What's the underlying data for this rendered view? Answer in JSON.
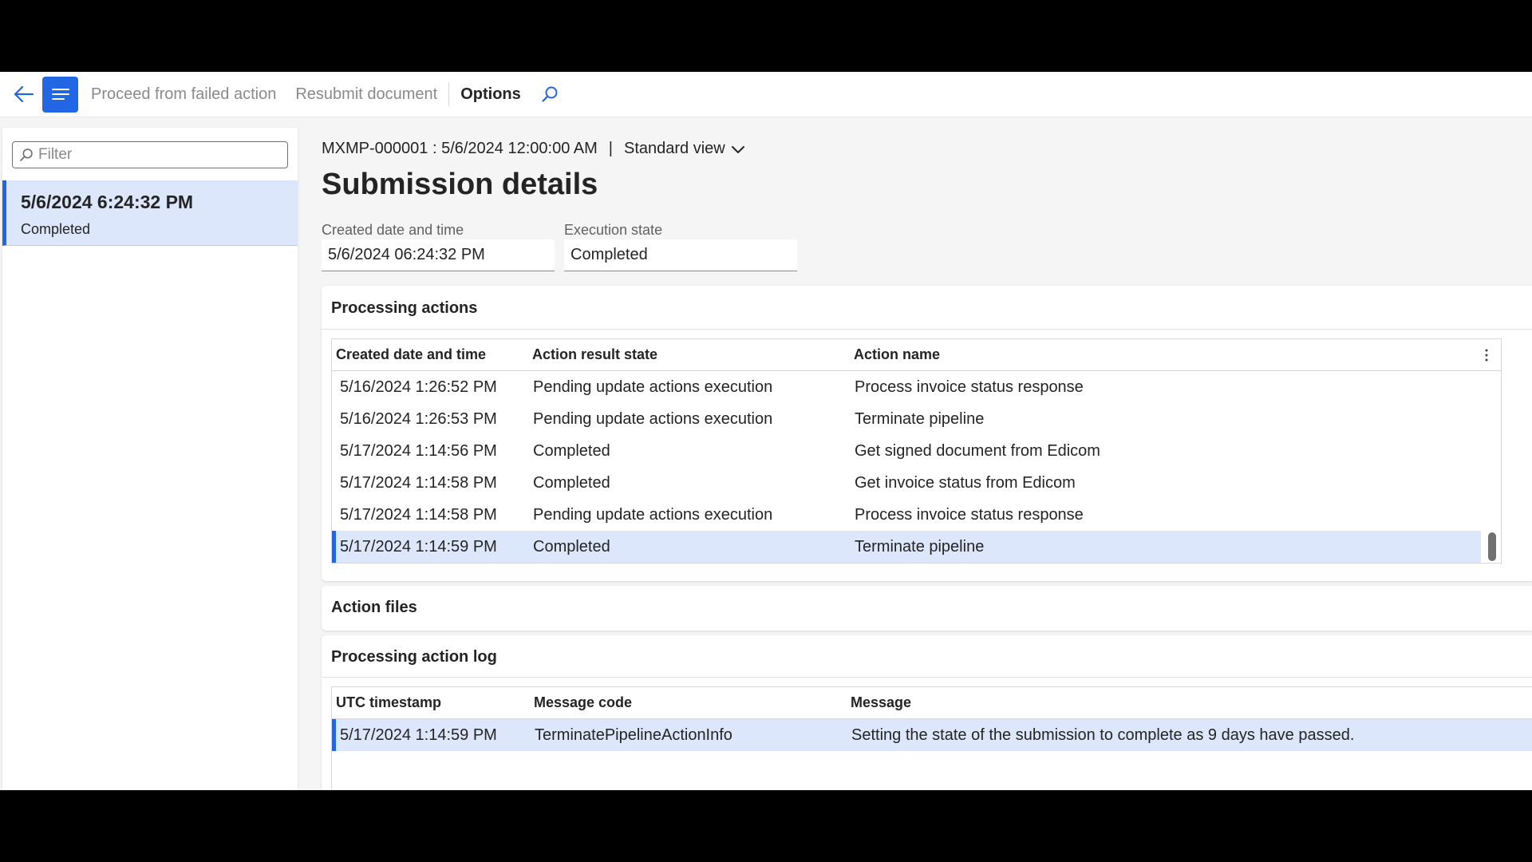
{
  "toolbar": {
    "back_icon": "back-arrow-icon",
    "menu_icon": "menu-lines-icon",
    "proceed_label": "Proceed from failed action",
    "resubmit_label": "Resubmit document",
    "options_label": "Options",
    "search_icon": "search-icon"
  },
  "left_pane": {
    "filter_placeholder": "Filter",
    "items": [
      {
        "title": "5/6/2024 6:24:32 PM",
        "status": "Completed"
      }
    ]
  },
  "header": {
    "record": "MXMP-000001 : 5/6/2024 12:00:00 AM",
    "separator": "|",
    "view_label": "Standard view",
    "title": "Submission details"
  },
  "fields": {
    "created_label": "Created date and time",
    "created_value": "5/6/2024 06:24:32 PM",
    "execution_label": "Execution state",
    "execution_value": "Completed"
  },
  "processing_actions": {
    "title": "Processing actions",
    "columns": [
      "Created date and time",
      "Action result state",
      "Action name"
    ],
    "rows": [
      [
        "5/16/2024 1:26:52 PM",
        "Pending update actions execution",
        "Process invoice status response"
      ],
      [
        "5/16/2024 1:26:53 PM",
        "Pending update actions execution",
        "Terminate pipeline"
      ],
      [
        "5/17/2024 1:14:56 PM",
        "Completed",
        "Get signed document from Edicom"
      ],
      [
        "5/17/2024 1:14:58 PM",
        "Completed",
        "Get invoice status from Edicom"
      ],
      [
        "5/17/2024 1:14:58 PM",
        "Pending update actions execution",
        "Process invoice status response"
      ],
      [
        "5/17/2024 1:14:59 PM",
        "Completed",
        "Terminate pipeline"
      ]
    ]
  },
  "action_files": {
    "title": "Action files"
  },
  "action_log": {
    "title": "Processing action log",
    "columns": [
      "UTC timestamp",
      "Message code",
      "Message"
    ],
    "rows": [
      [
        "5/17/2024 1:14:59 PM",
        "TerminatePipelineActionInfo",
        "Setting the state of the submission to complete as 9 days have passed."
      ]
    ]
  },
  "colors": {
    "accent": "#2266e3",
    "selected_row": "#dde7fb"
  }
}
